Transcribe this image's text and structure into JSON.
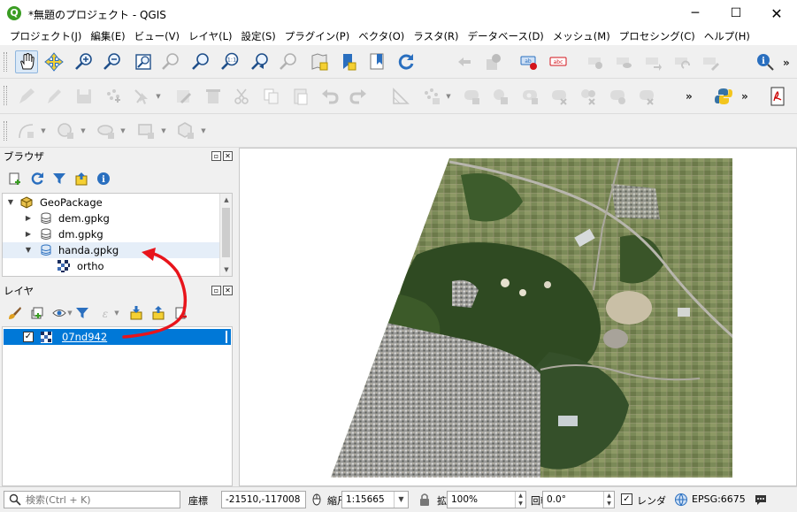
{
  "window": {
    "title": "*無題のプロジェクト - QGIS",
    "app_icon": "qgis-logo-icon",
    "minimize": "─",
    "maximize": "☐",
    "close": "✕"
  },
  "menu": [
    "プロジェクト(J)",
    "編集(E)",
    "ビュー(V)",
    "レイヤ(L)",
    "設定(S)",
    "プラグイン(P)",
    "ベクタ(O)",
    "ラスタ(R)",
    "データベース(D)",
    "メッシュ(M)",
    "プロセシング(C)",
    "ヘルプ(H)"
  ],
  "toolbar": {
    "overflow": "»"
  },
  "browser_panel": {
    "title": "ブラウザ",
    "tree": [
      {
        "label": "GeoPackage",
        "icon": "geopackage-icon",
        "expanded": true
      },
      {
        "label": "dem.gpkg",
        "icon": "database-icon",
        "expanded": false
      },
      {
        "label": "dm.gpkg",
        "icon": "database-icon",
        "expanded": false
      },
      {
        "label": "handa.gpkg",
        "icon": "database-icon",
        "expanded": true
      },
      {
        "label": "ortho",
        "icon": "raster-layer-icon"
      }
    ]
  },
  "layers_panel": {
    "title": "レイヤ",
    "layers": [
      {
        "name": "07nd942",
        "checked": true,
        "selected": true
      }
    ]
  },
  "statusbar": {
    "search_placeholder": "検索(Ctrl + K)",
    "coord_label": "座標",
    "coordinate": "-21510,-117008",
    "scale_label": "縮尺",
    "scale": "1:15665",
    "magnifier_label": "拡大",
    "magnifier": "100%",
    "rotation_label": "回転",
    "rotation": "0.0°",
    "render_label": "レンダ",
    "render_checked": true,
    "crs": "EPSG:6675"
  },
  "colors": {
    "selection": "#0078d7",
    "annotation_arrow": "#e8141b",
    "qgis_green": "#3a9d23"
  }
}
